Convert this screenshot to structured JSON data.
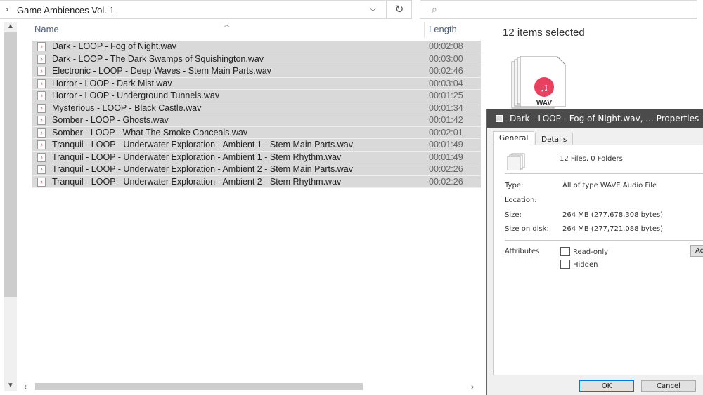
{
  "address": {
    "path": "Game Ambiences Vol. 1",
    "chevron_icon": "chevron-right",
    "dropdown_icon": "chevron-down",
    "refresh_icon": "refresh",
    "search_icon": "search"
  },
  "columns": {
    "name": "Name",
    "length": "Length"
  },
  "files": [
    {
      "name": "Dark - LOOP - Fog of Night.wav",
      "length": "00:02:08"
    },
    {
      "name": "Dark - LOOP - The Dark Swamps of Squishington.wav",
      "length": "00:03:00"
    },
    {
      "name": "Electronic - LOOP - Deep Waves - Stem Main Parts.wav",
      "length": "00:02:46"
    },
    {
      "name": "Horror - LOOP - Dark Mist.wav",
      "length": "00:03:04"
    },
    {
      "name": "Horror - LOOP - Underground Tunnels.wav",
      "length": "00:01:25"
    },
    {
      "name": "Mysterious - LOOP - Black Castle.wav",
      "length": "00:01:34"
    },
    {
      "name": "Somber - LOOP - Ghosts.wav",
      "length": "00:01:42"
    },
    {
      "name": "Somber - LOOP - What The Smoke Conceals.wav",
      "length": "00:02:01"
    },
    {
      "name": "Tranquil - LOOP - Underwater Exploration - Ambient 1 - Stem Main Parts.wav",
      "length": "00:01:49"
    },
    {
      "name": "Tranquil - LOOP - Underwater Exploration - Ambient 1 - Stem Rhythm.wav",
      "length": "00:01:49"
    },
    {
      "name": "Tranquil - LOOP - Underwater Exploration - Ambient 2 - Stem Main Parts.wav",
      "length": "00:02:26"
    },
    {
      "name": "Tranquil - LOOP - Underwater Exploration - Ambient 2 - Stem Rhythm.wav",
      "length": "00:02:26"
    }
  ],
  "details": {
    "selected": "12 items selected",
    "icon_label": "WAV"
  },
  "dialog": {
    "title": "Dark - LOOP - Fog of Night.wav, ... Properties",
    "tabs": [
      "General",
      "Details"
    ],
    "summary": "12 Files, 0 Folders",
    "type_label": "Type:",
    "type_value": "All of type WAVE Audio File",
    "location_label": "Location:",
    "size_label": "Size:",
    "size_value": "264 MB (277,678,308 bytes)",
    "disk_label": "Size on disk:",
    "disk_value": "264 MB (277,721,088 bytes)",
    "attributes_label": "Attributes",
    "readonly": {
      "label": "Read-only",
      "checked": false
    },
    "hidden": {
      "label": "Hidden",
      "checked": false
    },
    "advanced": "Ad",
    "ok": "OK",
    "cancel": "Cancel"
  }
}
